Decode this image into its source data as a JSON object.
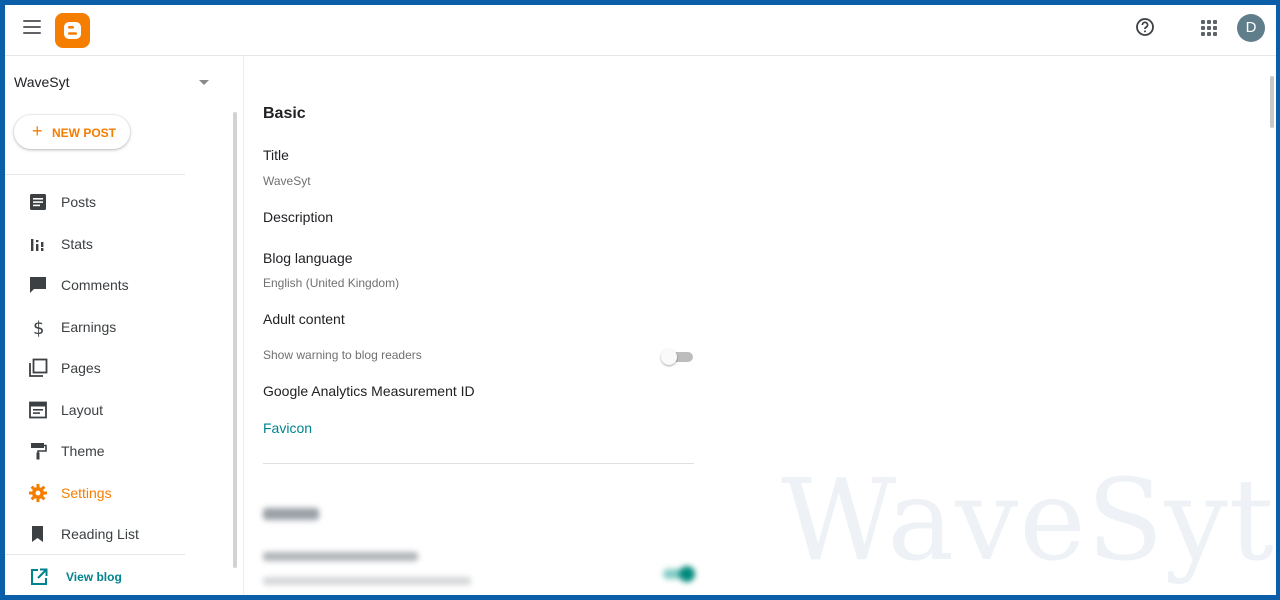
{
  "header": {
    "avatar_initial": "D"
  },
  "sidebar": {
    "blog_name": "WaveSyt",
    "new_post_label": "NEW POST",
    "items": [
      {
        "label": "Posts",
        "icon": "posts-icon"
      },
      {
        "label": "Stats",
        "icon": "stats-icon"
      },
      {
        "label": "Comments",
        "icon": "comments-icon"
      },
      {
        "label": "Earnings",
        "icon": "dollar-icon"
      },
      {
        "label": "Pages",
        "icon": "pages-icon"
      },
      {
        "label": "Layout",
        "icon": "layout-icon"
      },
      {
        "label": "Theme",
        "icon": "paint-roller-icon"
      },
      {
        "label": "Settings",
        "icon": "gear-icon",
        "active": true
      },
      {
        "label": "Reading List",
        "icon": "bookmark-icon"
      }
    ],
    "view_blog_label": "View blog"
  },
  "main": {
    "section_title": "Basic",
    "title_label": "Title",
    "title_value": "WaveSyt",
    "description_label": "Description",
    "language_label": "Blog language",
    "language_value": "English (United Kingdom)",
    "adult_label": "Adult content",
    "adult_toggle_label": "Show warning to blog readers",
    "adult_toggle_on": false,
    "analytics_label": "Google Analytics Measurement ID",
    "favicon_label": "Favicon",
    "watermark": "WaveSyt"
  },
  "colors": {
    "brand": "#f57d00",
    "link": "#00838f",
    "frame": "#0b5ea8"
  }
}
